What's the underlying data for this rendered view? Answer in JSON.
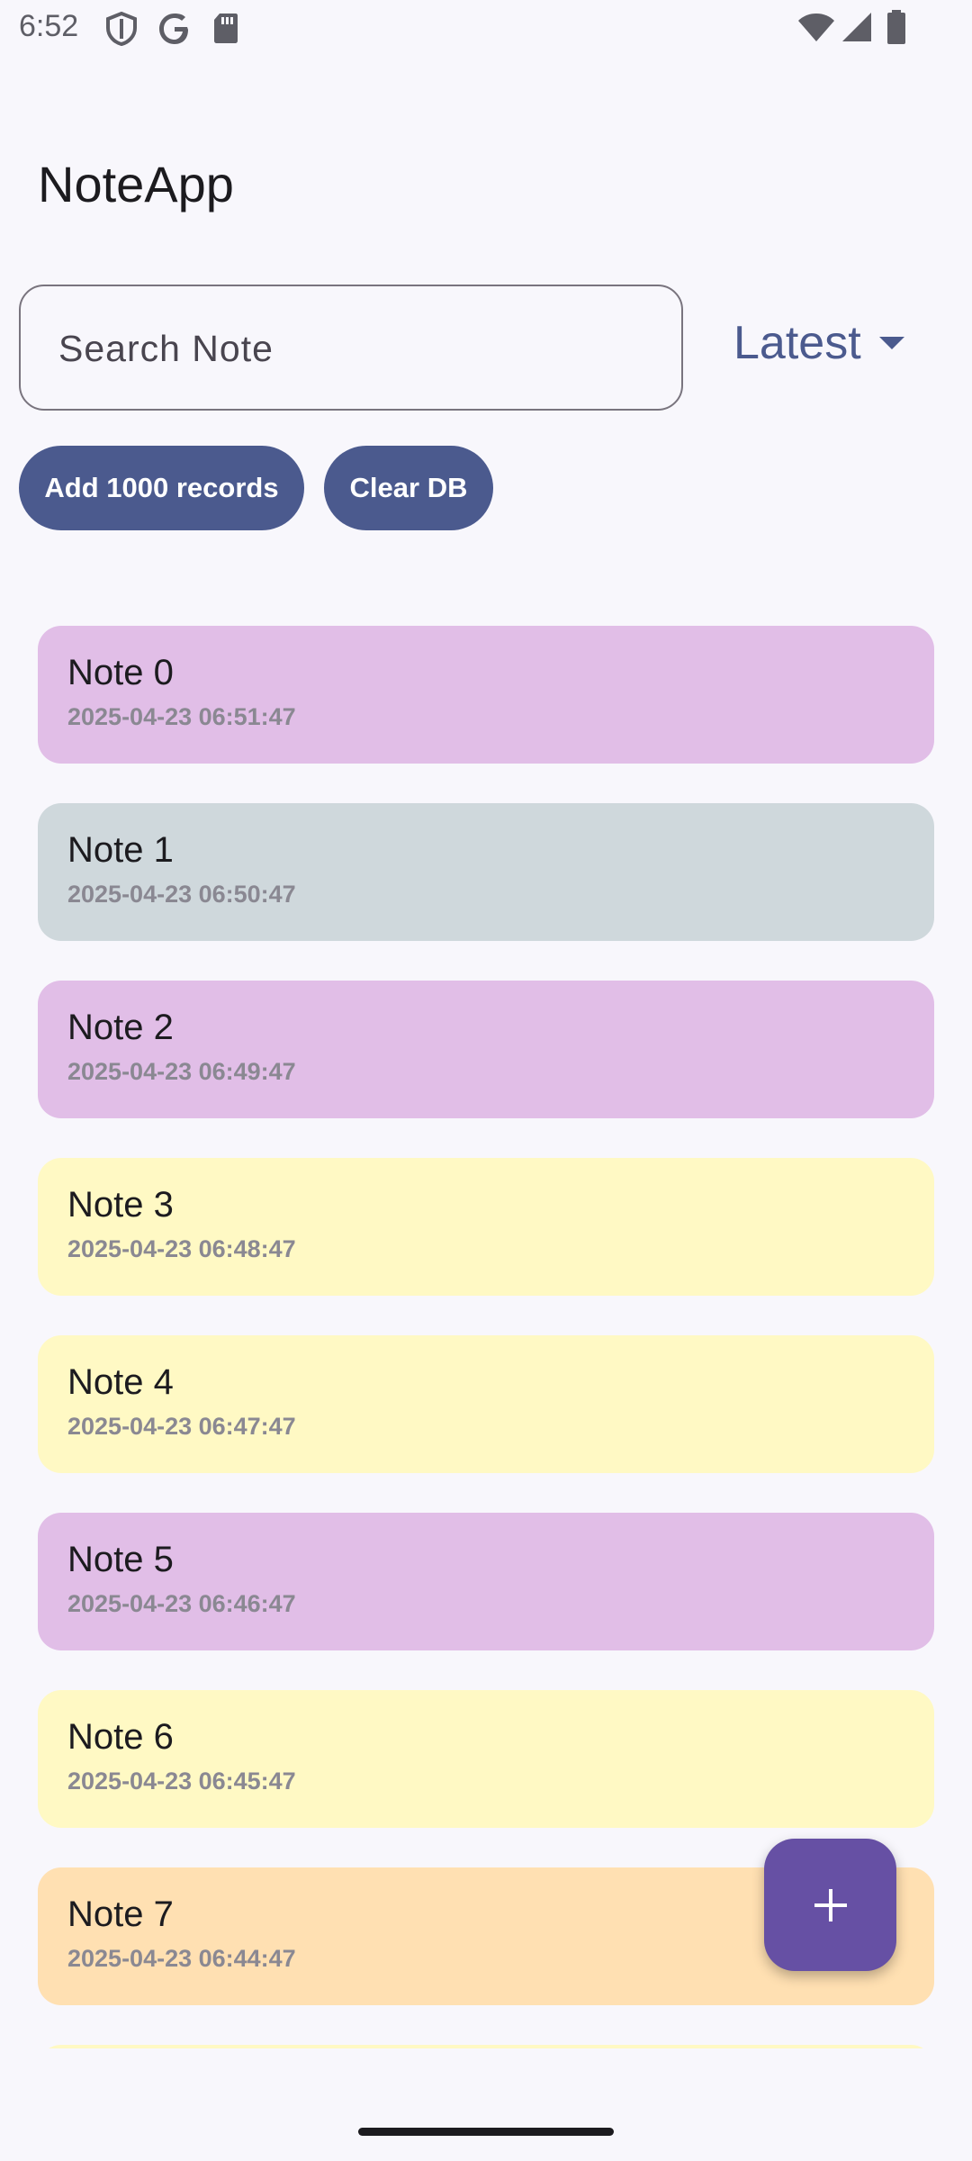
{
  "status_bar": {
    "time": "6:52",
    "left_icons": [
      "shield-icon",
      "google-icon",
      "sd-card-icon"
    ],
    "right_icons": [
      "wifi-icon",
      "signal-icon",
      "battery-icon"
    ]
  },
  "app": {
    "title": "NoteApp"
  },
  "search": {
    "placeholder": "Search Note",
    "value": ""
  },
  "sort": {
    "selected": "Latest",
    "icon": "caret-down-icon",
    "accent_color": "#4B5A8E"
  },
  "actions": {
    "add_label": "Add 1000 records",
    "clear_label": "Clear DB",
    "button_color": "#4B5A8E"
  },
  "notes": [
    {
      "title": "Note 0",
      "date": "2025-04-23 06:51:47",
      "color": "#E1BEE7"
    },
    {
      "title": "Note 1",
      "date": "2025-04-23 06:50:47",
      "color": "#CFD8DC"
    },
    {
      "title": "Note 2",
      "date": "2025-04-23 06:49:47",
      "color": "#E1BEE7"
    },
    {
      "title": "Note 3",
      "date": "2025-04-23 06:48:47",
      "color": "#FFF9C4"
    },
    {
      "title": "Note 4",
      "date": "2025-04-23 06:47:47",
      "color": "#FFF9C4"
    },
    {
      "title": "Note 5",
      "date": "2025-04-23 06:46:47",
      "color": "#E1BEE7"
    },
    {
      "title": "Note 6",
      "date": "2025-04-23 06:45:47",
      "color": "#FFF9C4"
    },
    {
      "title": "Note 7",
      "date": "2025-04-23 06:44:47",
      "color": "#FFE0B2"
    },
    {
      "title": "",
      "date": "",
      "color": "#FFF9C4"
    }
  ],
  "fab": {
    "icon": "plus-icon",
    "color": "#6650A4"
  }
}
